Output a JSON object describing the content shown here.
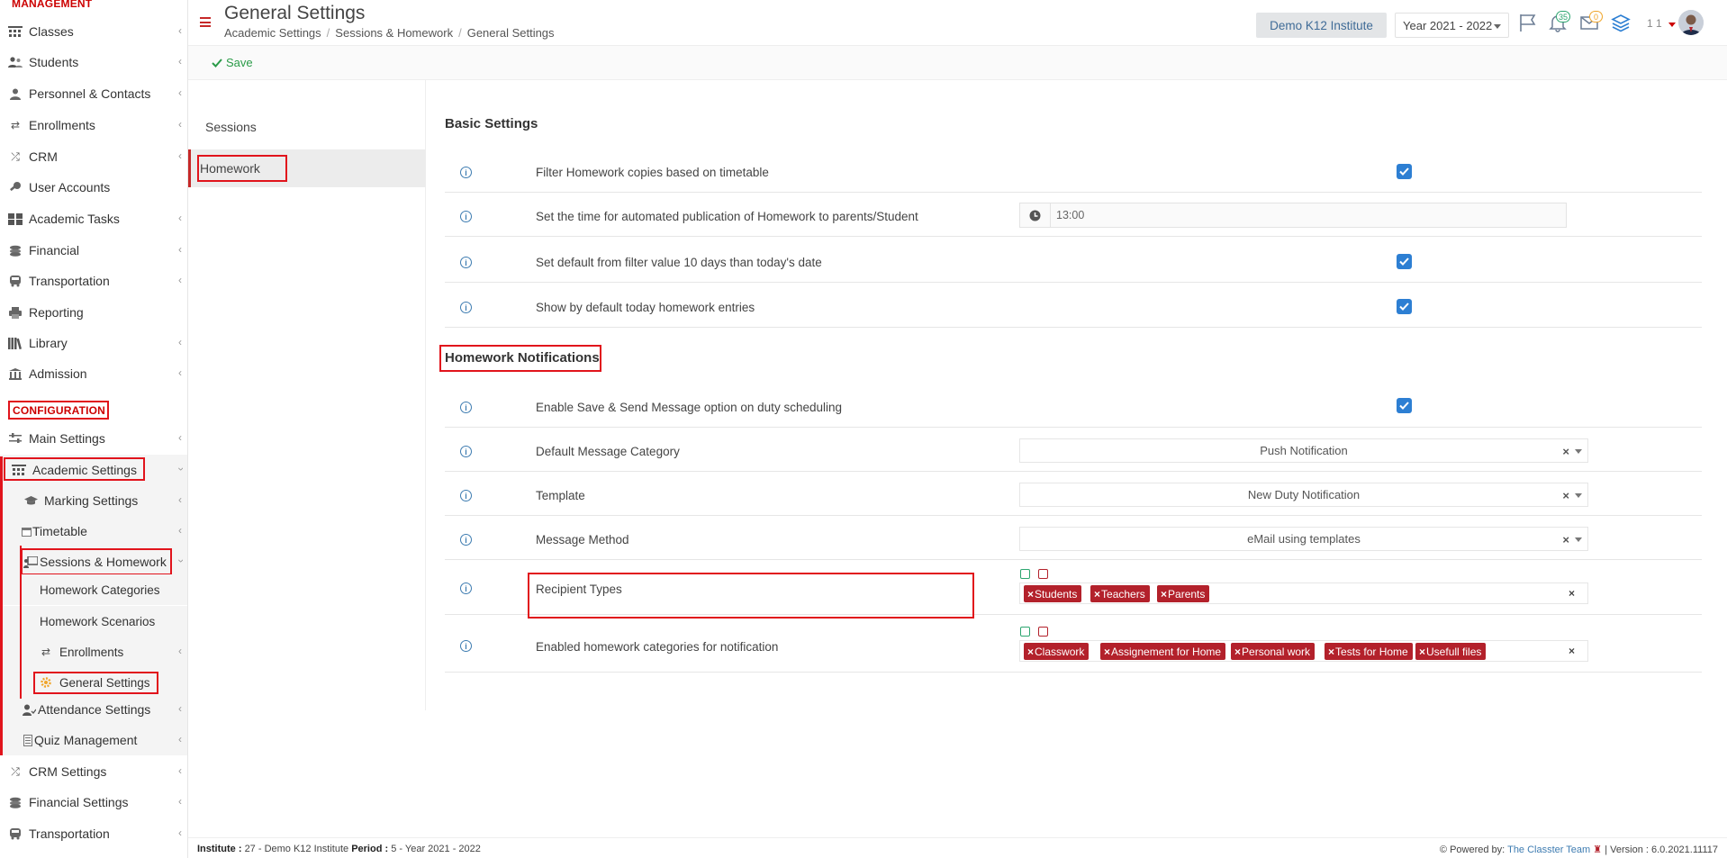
{
  "sidebar": {
    "management_label": "MANAGEMENT",
    "items": [
      {
        "label": "Classes",
        "icon": "classes-icon"
      },
      {
        "label": "Students",
        "icon": "students-icon"
      },
      {
        "label": "Personnel & Contacts",
        "icon": "personnel-icon"
      },
      {
        "label": "Enrollments",
        "icon": "enrollments-icon"
      },
      {
        "label": "CRM",
        "icon": "crm-icon"
      },
      {
        "label": "User Accounts",
        "icon": "key-icon"
      },
      {
        "label": "Academic Tasks",
        "icon": "tasks-icon"
      },
      {
        "label": "Financial",
        "icon": "financial-icon"
      },
      {
        "label": "Transportation",
        "icon": "bus-icon"
      },
      {
        "label": "Reporting",
        "icon": "printer-icon"
      },
      {
        "label": "Library",
        "icon": "library-icon"
      },
      {
        "label": "Admission",
        "icon": "admission-icon"
      }
    ],
    "configuration_label": "CONFIGURATION",
    "config_items": [
      {
        "label": "Main Settings"
      },
      {
        "label": "Academic Settings"
      },
      {
        "label": "Marking Settings"
      },
      {
        "label": "Timetable"
      },
      {
        "label": "Sessions & Homework"
      },
      {
        "label": "Homework Categories"
      },
      {
        "label": "Homework Scenarios"
      },
      {
        "label": "Enrollments"
      },
      {
        "label": "General Settings"
      },
      {
        "label": "Attendance Settings"
      },
      {
        "label": "Quiz Management"
      },
      {
        "label": "CRM Settings"
      },
      {
        "label": "Financial Settings"
      },
      {
        "label": "Transportation"
      }
    ]
  },
  "header": {
    "title": "General Settings",
    "breadcrumb": [
      "Academic Settings",
      "Sessions & Homework",
      "General Settings"
    ],
    "institute": "Demo K12 Institute",
    "year": "Year 2021 - 2022",
    "notifications_count": "35",
    "messages_count": "0",
    "user_number": "1 1"
  },
  "toolbar": {
    "save_label": "Save"
  },
  "tabs": [
    {
      "label": "Sessions"
    },
    {
      "label": "Homework"
    }
  ],
  "basic": {
    "title": "Basic Settings",
    "rows": [
      {
        "label": "Filter Homework copies based on timetable",
        "checked": true
      },
      {
        "label": "Set the time for automated publication of Homework to parents/Student",
        "value": "13:00"
      },
      {
        "label": "Set default from filter value 10 days than today's date",
        "checked": true
      },
      {
        "label": "Show by default today homework entries",
        "checked": true
      }
    ]
  },
  "notifications": {
    "title": "Homework Notifications",
    "enable_label": "Enable Save & Send Message option on duty scheduling",
    "enable_checked": true,
    "category_label": "Default Message Category",
    "category_value": "Push Notification",
    "template_label": "Template",
    "template_value": "New Duty Notification",
    "method_label": "Message Method",
    "method_value": "eMail using templates",
    "recipient_label": "Recipient Types",
    "recipient_tags": [
      "Students",
      "Teachers",
      "Parents"
    ],
    "categories_label": "Enabled homework categories for notification",
    "category_tags": [
      "Classwork",
      "Assignement for Home",
      "Personal work",
      "Tests for Home",
      "Usefull files"
    ]
  },
  "footer": {
    "institute_label": "Institute :",
    "institute_value": "27 - Demo K12 Institute",
    "period_label": "Period :",
    "period_value": "5 - Year 2021 - 2022",
    "powered_by": "Powered by:",
    "team": "The Classter Team",
    "version": "| Version : 6.0.2021.11117"
  },
  "colors": {
    "accent": "#c62828",
    "checkbox": "#2d7fd3",
    "tag": "#b3212b",
    "save": "#2a9b48",
    "link": "#3e7cb1"
  }
}
